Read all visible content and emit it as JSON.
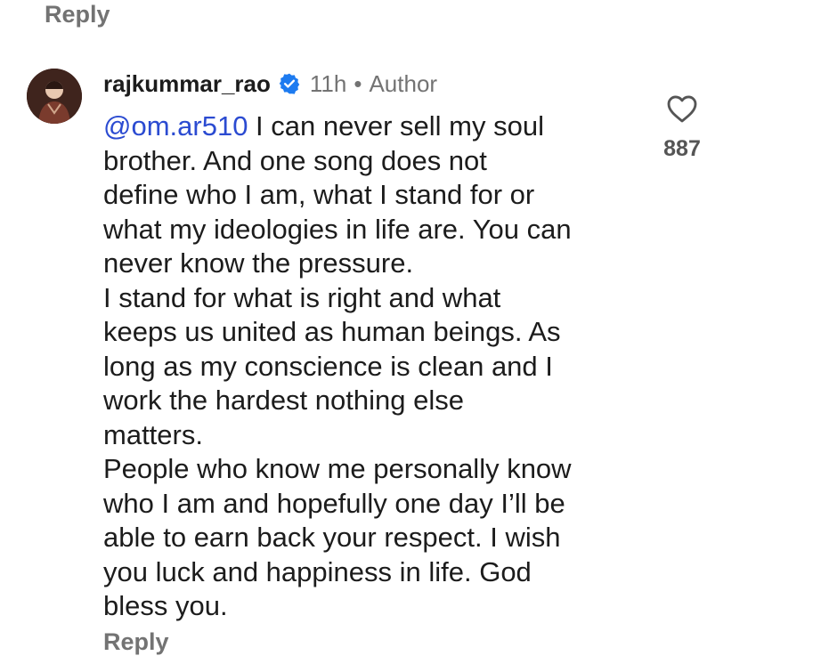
{
  "top_reply_label": "Reply",
  "comment": {
    "username": "rajkummar_rao",
    "time": "11h",
    "dot": "•",
    "role": "Author",
    "mention": "@om.ar510",
    "lines": [
      " I can never sell my soul",
      "brother. And one song does not",
      "define who I am, what I stand for or",
      "what my ideologies in life are. You can",
      "never know the pressure.",
      "I stand for what is right and what",
      "keeps us united as human beings. As",
      "long as my conscience is clean and I",
      "work the hardest nothing else",
      "matters.",
      "People who know me personally know",
      "who I am  and hopefully one day I’ll be",
      "able to earn back your respect. I wish",
      "you luck and happiness in life. God",
      "bless you."
    ],
    "likes": "887",
    "reply_label": "Reply"
  },
  "colors": {
    "mention": "#2b4bd1",
    "verified": "#1d7bf0",
    "muted_text": "#737373"
  },
  "icons": {
    "verified": "verified-badge-icon",
    "like": "heart-icon"
  }
}
